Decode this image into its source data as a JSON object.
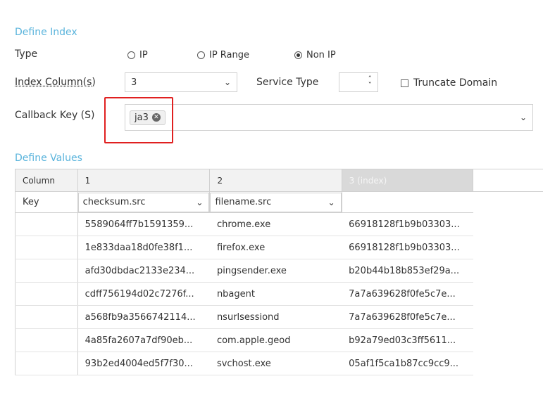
{
  "define_index": {
    "title": "Define Index",
    "type_label": "Type",
    "type_options": [
      {
        "label": "IP",
        "selected": false
      },
      {
        "label": "IP Range",
        "selected": false
      },
      {
        "label": "Non IP",
        "selected": true
      }
    ],
    "index_columns_label": "Index Column(s)",
    "index_columns_value": "3",
    "service_type_label": "Service Type",
    "service_type_value": "",
    "truncate_domain_label": "Truncate Domain",
    "truncate_domain_checked": false,
    "callback_key_label": "Callback Key (S)",
    "callback_key_tags": [
      "ja3"
    ]
  },
  "define_values": {
    "title": "Define Values",
    "headers": [
      "Column",
      "1",
      "2",
      "3 (index)"
    ],
    "key_row": {
      "label": "Key",
      "col1": "checksum.src",
      "col2": "filename.src"
    },
    "rows": [
      [
        "5589064ff7b1591359...",
        "chrome.exe",
        "66918128f1b9b03303..."
      ],
      [
        "1e833daa18d0fe38f1...",
        "firefox.exe",
        "66918128f1b9b03303..."
      ],
      [
        "afd30dbdac2133e234...",
        "pingsender.exe",
        "b20b44b18b853ef29a..."
      ],
      [
        "cdff756194d02c7276f...",
        "nbagent",
        "7a7a639628f0fe5c7e..."
      ],
      [
        "a568fb9a3566742114...",
        "nsurlsessiond",
        "7a7a639628f0fe5c7e..."
      ],
      [
        "4a85fa2607a7df90eb...",
        "com.apple.geod",
        "b92a79ed03c3ff5611..."
      ],
      [
        "93b2ed4004ed5f7f30...",
        "svchost.exe",
        "05af1f5ca1b87cc9cc9..."
      ]
    ]
  },
  "colors": {
    "accent": "#5ab4dc",
    "highlight": "#e02020"
  }
}
